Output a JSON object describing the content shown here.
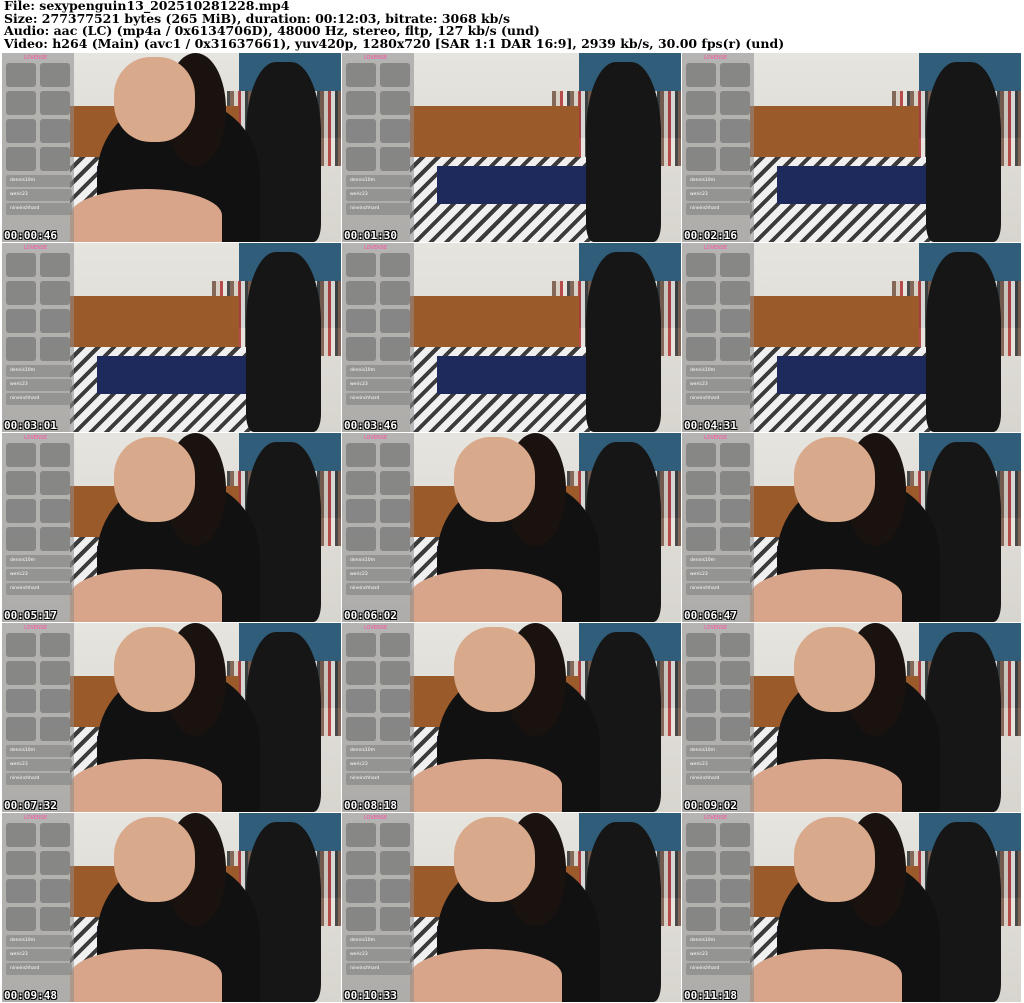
{
  "header": {
    "file": "File: sexypenguin13_202510281228.mp4",
    "size": "Size: 277377521 bytes (265 MiB), duration: 00:12:03, bitrate: 3068 kb/s",
    "audio": "Audio: aac (LC) (mp4a / 0x6134706D), 48000 Hz, stereo, fltp, 127 kb/s (und)",
    "video": "Video: h264 (Main) (avc1 / 0x31637661), yuv420p, 1280x720 [SAR 1:1 DAR 16:9], 2939 kb/s, 30.00 fps(r) (und)"
  },
  "overlay": {
    "brand": "LOVENSE",
    "users": [
      "dennis10m",
      "weric23",
      "nineinchhard"
    ]
  },
  "thumbnails": [
    {
      "timestamp": "00:00:46",
      "scene": "person"
    },
    {
      "timestamp": "00:01:30",
      "scene": "room"
    },
    {
      "timestamp": "00:02:16",
      "scene": "room"
    },
    {
      "timestamp": "00:03:01",
      "scene": "room"
    },
    {
      "timestamp": "00:03:46",
      "scene": "room"
    },
    {
      "timestamp": "00:04:31",
      "scene": "room"
    },
    {
      "timestamp": "00:05:17",
      "scene": "person"
    },
    {
      "timestamp": "00:06:02",
      "scene": "person"
    },
    {
      "timestamp": "00:06:47",
      "scene": "person"
    },
    {
      "timestamp": "00:07:32",
      "scene": "person"
    },
    {
      "timestamp": "00:08:18",
      "scene": "person"
    },
    {
      "timestamp": "00:09:02",
      "scene": "person"
    },
    {
      "timestamp": "00:09:48",
      "scene": "person"
    },
    {
      "timestamp": "00:10:33",
      "scene": "person"
    },
    {
      "timestamp": "00:11:18",
      "scene": "person"
    }
  ]
}
